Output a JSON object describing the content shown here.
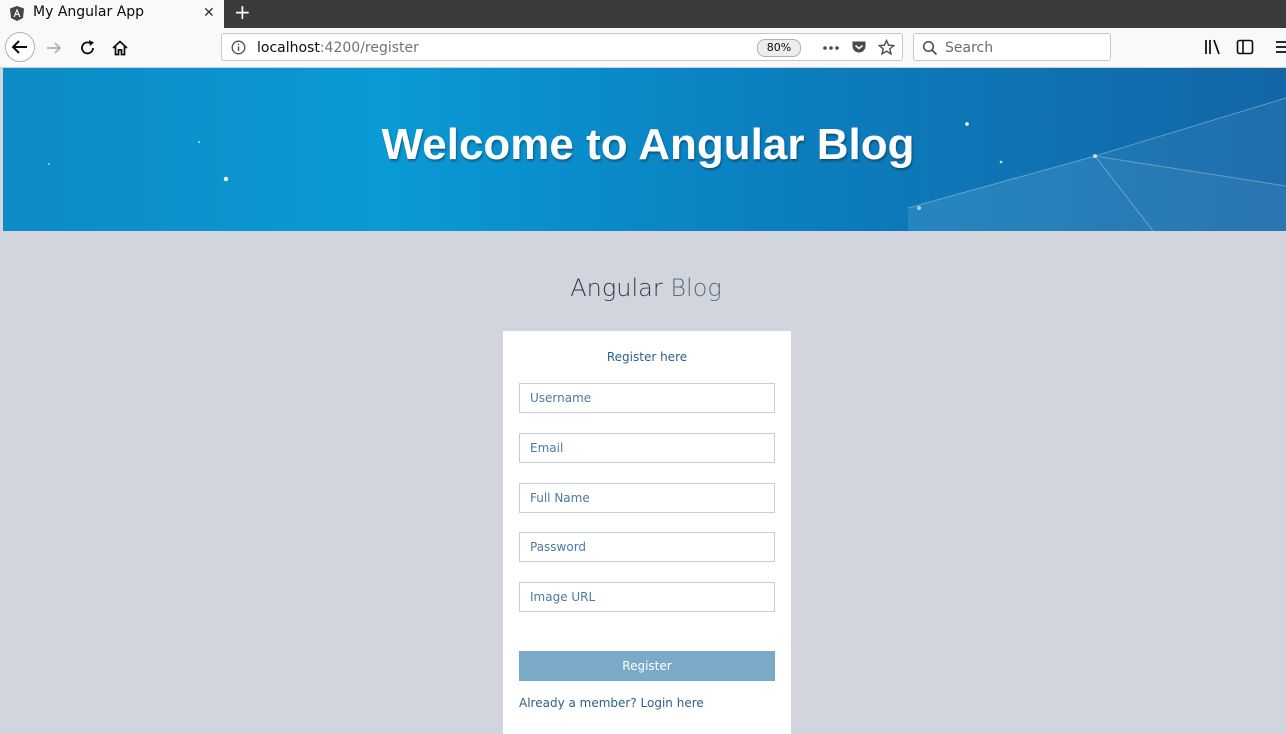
{
  "browser": {
    "tab_title": "My Angular App",
    "tab_close": "✕",
    "new_tab": "+",
    "url_host": "localhost",
    "url_path": ":4200/register",
    "zoom": "80%",
    "search_placeholder": "Search"
  },
  "hero": {
    "title": "Welcome to Angular Blog"
  },
  "brand": {
    "strong": "Angular",
    "light": "Blog"
  },
  "form": {
    "heading": "Register here",
    "fields": [
      {
        "placeholder": "Username"
      },
      {
        "placeholder": "Email"
      },
      {
        "placeholder": "Full Name"
      },
      {
        "placeholder": "Password"
      },
      {
        "placeholder": "Image URL"
      }
    ],
    "submit_label": "Register",
    "login_link": "Already a member? Login here"
  }
}
